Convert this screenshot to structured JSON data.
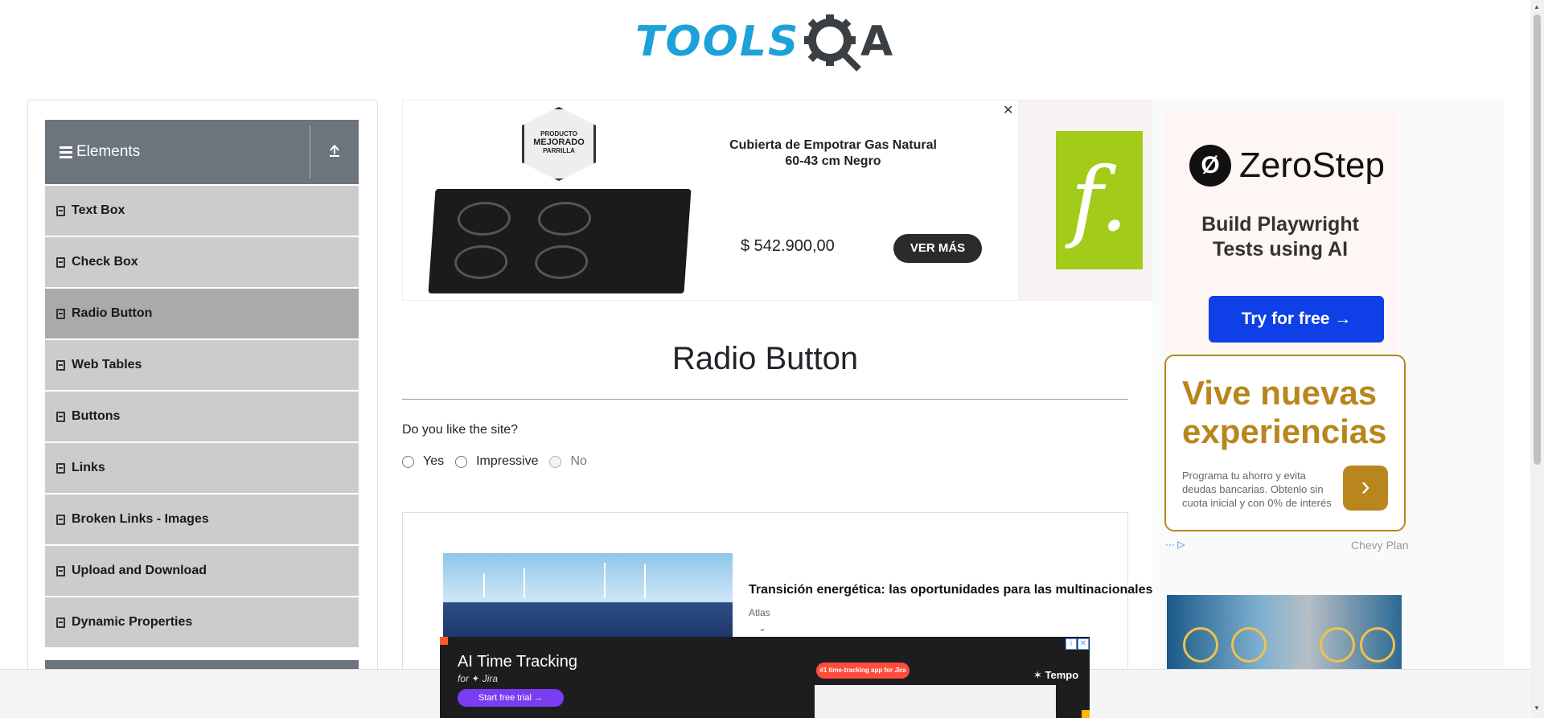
{
  "header": {
    "logo_text": "TOOLS",
    "logo_letter": "A"
  },
  "sidebar": {
    "group_title": "Elements",
    "collapse_icon": "up-arrow-icon",
    "items": [
      {
        "label": "Text Box"
      },
      {
        "label": "Check Box"
      },
      {
        "label": "Radio Button",
        "active": true
      },
      {
        "label": "Web Tables"
      },
      {
        "label": "Buttons"
      },
      {
        "label": "Links"
      },
      {
        "label": "Broken Links - Images"
      },
      {
        "label": "Upload and Download"
      },
      {
        "label": "Dynamic Properties"
      }
    ]
  },
  "ad_top": {
    "badge_line1": "PRODUCTO",
    "badge_line2": "MEJORADO",
    "badge_line3": "PARRILLA",
    "product_name": "Cubierta de Empotrar Gas Natural 60-43 cm Negro",
    "price": "$ 542.900,00",
    "cta": "VER MÁS",
    "close": "✕",
    "brand_glyph": "f."
  },
  "main": {
    "title": "Radio Button",
    "question": "Do you like the site?",
    "options": [
      {
        "label": "Yes",
        "disabled": false
      },
      {
        "label": "Impressive",
        "disabled": false
      },
      {
        "label": "No",
        "disabled": true
      }
    ]
  },
  "article": {
    "headline": "Transición energética: las oportunidades para las multinacionales",
    "source": "Atlas",
    "chevron": "⌄"
  },
  "ad_right": {
    "zs_name": "ZeroStep",
    "zs_tagline_1": "Build Playwright",
    "zs_tagline_2": "Tests using AI",
    "zs_button": "Try for free →",
    "vn_title_1": "Vive nuevas",
    "vn_title_2": "experiencias",
    "vn_body": "Programa tu ahorro y evita deudas bancarias. Obtenlo sin cuota inicial y con 0% de interés",
    "vn_arrow": "›",
    "ad_info": "··· ▷",
    "sponsor": "Chevy Plan"
  },
  "ad_bottom": {
    "headline": "AI Time Tracking",
    "subline": "for ✦ Jira",
    "button": "Start free trial →",
    "pill": "#1 time-tracking app for Jira",
    "brand": "✶ Tempo",
    "info": "i",
    "close": "✕"
  },
  "colors": {
    "sidebar_header": "#6c757d",
    "menu_item": "#cccccc",
    "menu_active": "#aaaaaa",
    "logo_blue": "#1da1d9"
  }
}
